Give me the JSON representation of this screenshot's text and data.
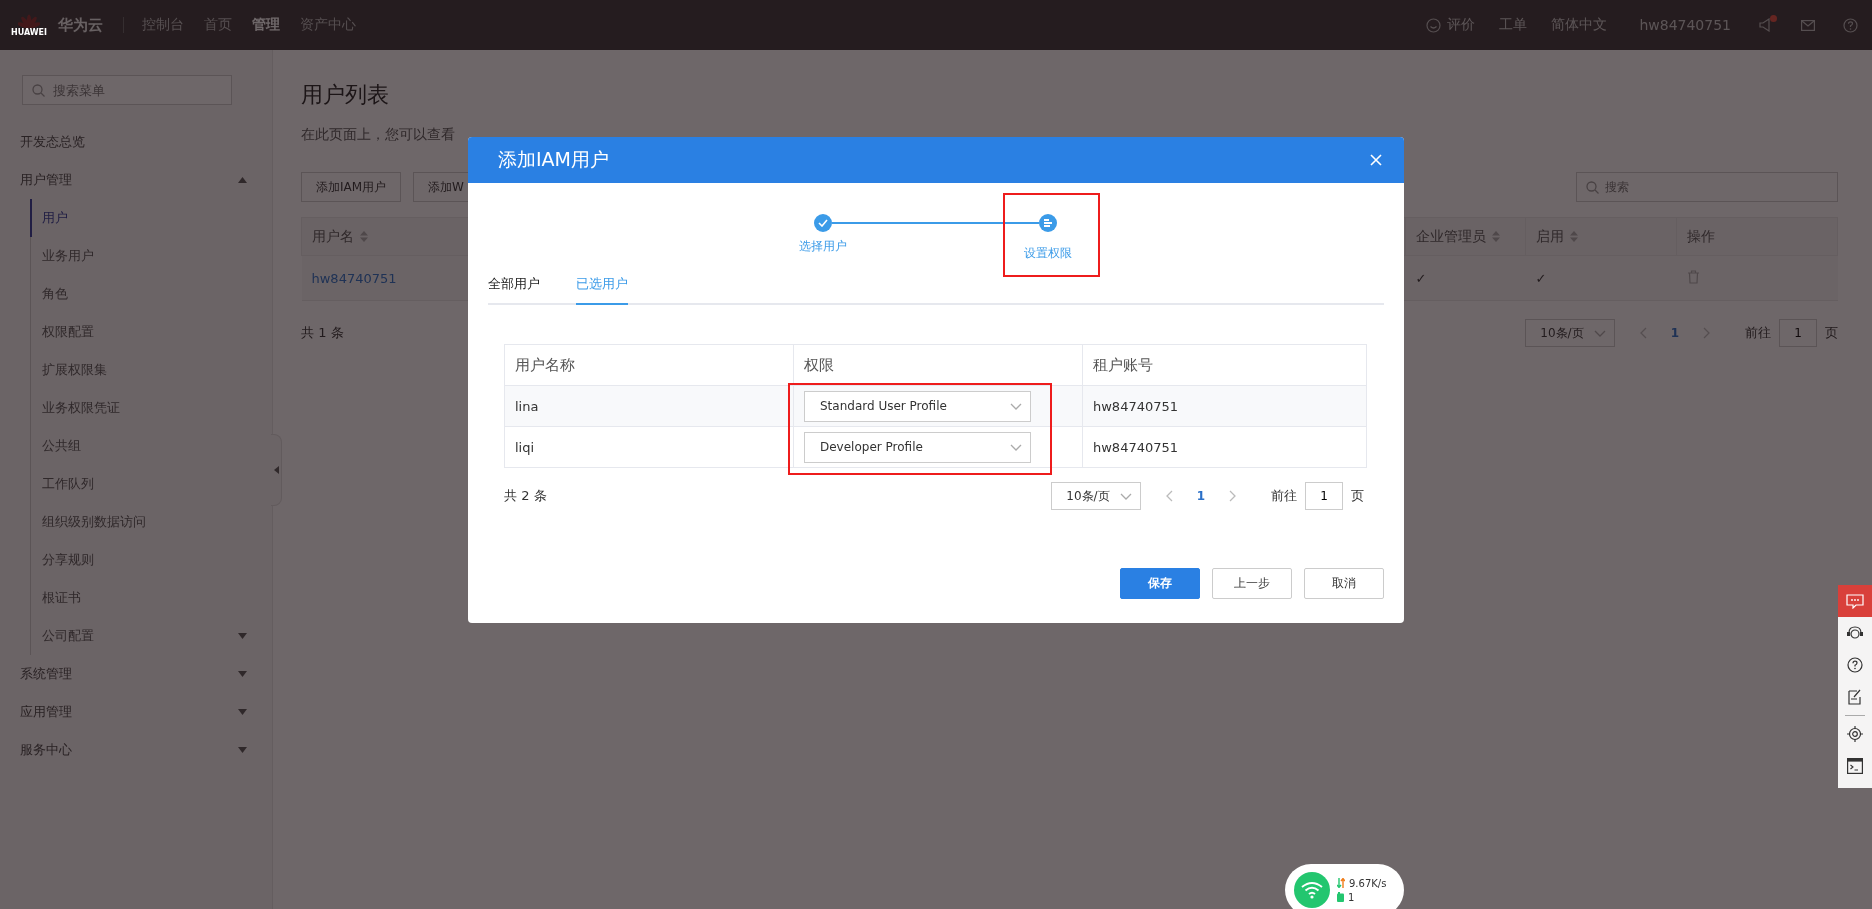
{
  "topbar": {
    "logo_text": "HUAWEI",
    "brand": "华为云",
    "nav": [
      {
        "label": "控制台",
        "selected": false
      },
      {
        "label": "首页",
        "selected": false
      },
      {
        "label": "管理",
        "selected": true
      },
      {
        "label": "资产中心",
        "selected": false
      }
    ],
    "feedback": "评价",
    "ticket": "工单",
    "language": "简体中文",
    "account": "hw84740751"
  },
  "sidebar": {
    "search_placeholder": "搜索菜单",
    "items": [
      {
        "label": "开发态总览",
        "kind": "link"
      },
      {
        "label": "用户管理",
        "kind": "group",
        "expanded": true,
        "children": [
          {
            "label": "用户",
            "selected": true
          },
          {
            "label": "业务用户",
            "selected": false
          },
          {
            "label": "角色",
            "selected": false
          },
          {
            "label": "权限配置",
            "selected": false
          },
          {
            "label": "扩展权限集",
            "selected": false
          },
          {
            "label": "业务权限凭证",
            "selected": false
          },
          {
            "label": "公共组",
            "selected": false
          },
          {
            "label": "工作队列",
            "selected": false
          },
          {
            "label": "组织级别数据访问",
            "selected": false
          },
          {
            "label": "分享规则",
            "selected": false
          },
          {
            "label": "根证书",
            "selected": false
          },
          {
            "label": "公司配置",
            "selected": false,
            "expandable": true
          }
        ]
      },
      {
        "label": "系统管理",
        "kind": "group",
        "expanded": false
      },
      {
        "label": "应用管理",
        "kind": "group",
        "expanded": false
      },
      {
        "label": "服务中心",
        "kind": "group",
        "expanded": false
      }
    ]
  },
  "page": {
    "title": "用户列表",
    "description": "在此页面上，您可以查看",
    "buttons": [
      "添加IAM用户",
      "添加W"
    ],
    "search_placeholder": "搜索",
    "columns": [
      {
        "label": "用户名",
        "sortable": true
      },
      {
        "label": "企业管理员",
        "sortable": true
      },
      {
        "label": "启用",
        "sortable": true
      },
      {
        "label": "操作",
        "sortable": false
      }
    ],
    "rows": [
      {
        "name": "hw84740751",
        "admin": "✓",
        "enabled": "✓"
      }
    ],
    "total": "共 1 条",
    "pager": {
      "page_size": "10条/页",
      "current": "1",
      "goto_label": "前往",
      "goto_value": "1",
      "page_unit": "页"
    }
  },
  "dialog": {
    "title": "添加IAM用户",
    "steps": [
      {
        "label": "选择用户",
        "kind": "done"
      },
      {
        "label": "设置权限",
        "kind": "current"
      }
    ],
    "tabs": [
      {
        "label": "全部用户",
        "selected": false
      },
      {
        "label": "已选用户",
        "selected": true
      }
    ],
    "columns": [
      "用户名称",
      "权限",
      "租户账号"
    ],
    "rows": [
      {
        "name": "lina",
        "profile": "Standard User Profile",
        "tenant": "hw84740751"
      },
      {
        "name": "liqi",
        "profile": "Developer Profile",
        "tenant": "hw84740751"
      }
    ],
    "total": "共 2 条",
    "pager": {
      "page_size": "10条/页",
      "current": "1",
      "goto_label": "前往",
      "goto_value": "1",
      "page_unit": "页"
    },
    "buttons": [
      {
        "label": "保存",
        "kind": "primary"
      },
      {
        "label": "上一步",
        "kind": "default"
      },
      {
        "label": "取消",
        "kind": "default"
      }
    ]
  },
  "network_widget": {
    "speed": "9.67K/s",
    "count": "1"
  }
}
